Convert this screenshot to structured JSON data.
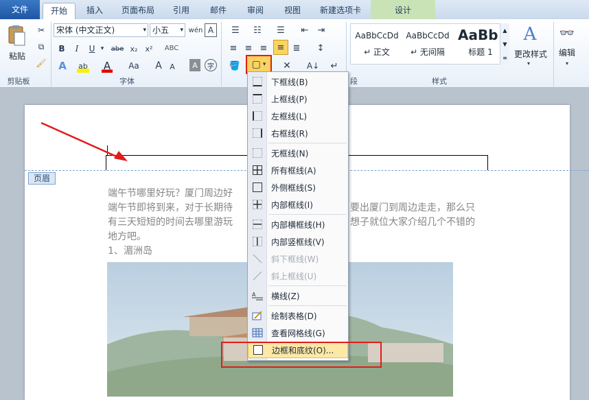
{
  "tabs": {
    "file": "文件",
    "items": [
      "开始",
      "插入",
      "页面布局",
      "引用",
      "邮件",
      "审阅",
      "视图",
      "新建选项卡",
      "设计"
    ]
  },
  "clipboard": {
    "paste_label": "粘贴",
    "group_label": "剪贴板"
  },
  "font": {
    "name": "宋体 (中文正文)",
    "size": "小五",
    "group_label": "字体",
    "bold": "B",
    "italic": "I",
    "underline": "U",
    "strike": "abe",
    "subscript": "x₂",
    "superscript": "x²",
    "case": "Aa",
    "grow": "A",
    "shrink": "A"
  },
  "paragraph": {
    "group_label": "段落"
  },
  "styles": {
    "group_label": "样式",
    "items": [
      {
        "preview": "AaBbCcDd",
        "name": "↵ 正文"
      },
      {
        "preview": "AaBbCcDd",
        "name": "↵ 无间隔"
      },
      {
        "preview": "AaBb",
        "name": "标题 1"
      }
    ],
    "change_label": "更改样式"
  },
  "editing": {
    "label": "编辑"
  },
  "header_label": "页眉",
  "document": {
    "lines": [
      "端午节哪里好玩？厦门周边好",
      "端午节即将到来，对于长期待",
      "有三天短短的时间去哪里游玩",
      "地方吧。",
      "1、湄洲岛"
    ],
    "lines_right": [
      "要出厦门到周边走走，那么只",
      "想子就位大家介绍几个不错的"
    ]
  },
  "border_menu": {
    "items": [
      {
        "label": "下框线(B)",
        "icon": "bottom-border-icon",
        "enabled": true
      },
      {
        "label": "上框线(P)",
        "icon": "top-border-icon",
        "enabled": true
      },
      {
        "label": "左框线(L)",
        "icon": "left-border-icon",
        "enabled": true
      },
      {
        "label": "右框线(R)",
        "icon": "right-border-icon",
        "enabled": true
      },
      {
        "label": "无框线(N)",
        "icon": "no-border-icon",
        "enabled": true
      },
      {
        "label": "所有框线(A)",
        "icon": "all-borders-icon",
        "enabled": true
      },
      {
        "label": "外侧框线(S)",
        "icon": "outside-borders-icon",
        "enabled": true
      },
      {
        "label": "内部框线(I)",
        "icon": "inside-borders-icon",
        "enabled": true
      },
      {
        "label": "内部横框线(H)",
        "icon": "inside-horizontal-border-icon",
        "enabled": true
      },
      {
        "label": "内部竖框线(V)",
        "icon": "inside-vertical-border-icon",
        "enabled": true
      },
      {
        "label": "斜下框线(W)",
        "icon": "diagonal-down-border-icon",
        "enabled": false
      },
      {
        "label": "斜上框线(U)",
        "icon": "diagonal-up-border-icon",
        "enabled": false
      },
      {
        "label": "横线(Z)",
        "icon": "horizontal-line-icon",
        "enabled": true
      },
      {
        "label": "绘制表格(D)",
        "icon": "draw-table-icon",
        "enabled": true
      },
      {
        "label": "查看网格线(G)",
        "icon": "view-gridlines-icon",
        "enabled": true
      },
      {
        "label": "边框和底纹(O)...",
        "icon": "borders-shading-icon",
        "enabled": true
      }
    ]
  },
  "colors": {
    "accent": "#1f56a3",
    "highlight_red": "#e21b1b",
    "menu_hover": "#fde9a6"
  }
}
